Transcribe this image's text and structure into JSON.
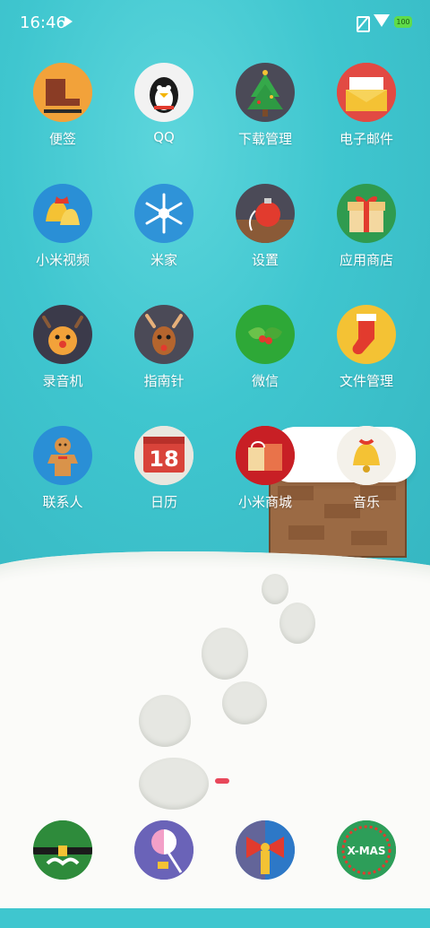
{
  "status_bar": {
    "time": "16:46",
    "battery": "100",
    "icons": [
      "play-store-icon",
      "no-sim-icon",
      "wifi-icon",
      "battery-icon"
    ]
  },
  "apps": [
    {
      "label": "便签",
      "icon": "ice-skate-icon",
      "bg": "#f2a23a"
    },
    {
      "label": "QQ",
      "icon": "penguin-icon",
      "bg": "#f2f2f2"
    },
    {
      "label": "下载管理",
      "icon": "christmas-tree-icon",
      "bg": "#4b4a57"
    },
    {
      "label": "电子邮件",
      "icon": "mail-envelope-icon",
      "bg": "#e24a43"
    },
    {
      "label": "小米视频",
      "icon": "bells-icon",
      "bg": "#2a8fd6"
    },
    {
      "label": "米家",
      "icon": "snowflake-icon",
      "bg": "#2f93d8"
    },
    {
      "label": "设置",
      "icon": "ornament-icon",
      "bg": "#4b4a57"
    },
    {
      "label": "应用商店",
      "icon": "gift-box-icon",
      "bg": "#2f9b4f"
    },
    {
      "label": "录音机",
      "icon": "reindeer-icon",
      "bg": "#3b3a4a"
    },
    {
      "label": "指南针",
      "icon": "reindeer-head-icon",
      "bg": "#4b4a57"
    },
    {
      "label": "微信",
      "icon": "holly-icon",
      "bg": "#2ea837"
    },
    {
      "label": "文件管理",
      "icon": "stocking-icon",
      "bg": "#f4c234"
    },
    {
      "label": "联系人",
      "icon": "gingerbread-man-icon",
      "bg": "#2a8fd6"
    },
    {
      "label": "日历",
      "icon": "calendar-icon",
      "bg": "#e9e7df",
      "date": "18"
    },
    {
      "label": "小米商城",
      "icon": "shopping-bag-icon",
      "bg": "#c81f25"
    },
    {
      "label": "音乐",
      "icon": "golden-bell-icon",
      "bg": "#f4f1ea"
    }
  ],
  "dock": [
    {
      "icon": "elf-hat-icon",
      "bg": "#2e8b3b"
    },
    {
      "icon": "lollipop-icon",
      "bg": "#6a63b8"
    },
    {
      "icon": "bow-icon",
      "bg": "#2d78c7"
    },
    {
      "icon": "xmas-badge-icon",
      "bg": "#2d9e59",
      "text": "X-MAS"
    }
  ]
}
